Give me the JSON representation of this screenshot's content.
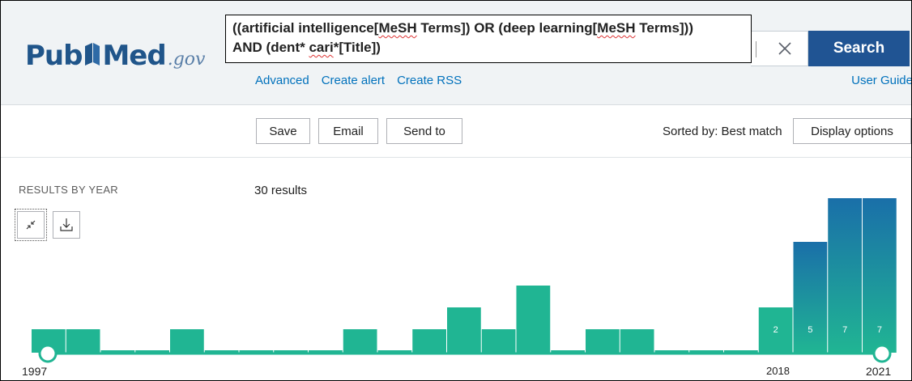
{
  "header": {
    "logo_pub": "Pub",
    "logo_med": "Med",
    "logo_gov": ".gov",
    "query_line1_a": "((artificial intelligence[",
    "query_line1_mesh1": "MeSH",
    "query_line1_b": " Terms]) OR (deep learning[",
    "query_line1_mesh2": "MeSH",
    "query_line1_c": " Terms]))",
    "query_line2_a": "AND (dent* ",
    "query_line2_cari": "cari",
    "query_line2_b": "*[Title])",
    "search_label": "Search",
    "links": [
      "Advanced",
      "Create alert",
      "Create RSS"
    ],
    "user_guide": "User Guide"
  },
  "toolbar": {
    "save": "Save",
    "email": "Email",
    "send_to": "Send to",
    "sorted_by": "Sorted by: Best match",
    "display_options": "Display options"
  },
  "results": {
    "section_label": "RESULTS BY YEAR",
    "count_text": "30 results"
  },
  "icons": {
    "collapse": "collapse-arrows-icon",
    "download": "download-icon",
    "clear": "close-icon"
  },
  "colors": {
    "brand": "#20558a",
    "search_button": "#205493",
    "link": "#0071bc",
    "bar": "#20b593",
    "bar_dark": "#1a6fa9",
    "timeline": "#20b593"
  },
  "chart_data": {
    "type": "bar",
    "categories": [
      "1997",
      "1998",
      "1999",
      "2000",
      "2001",
      "2002",
      "2003",
      "2004",
      "2005",
      "2006",
      "2007",
      "2008",
      "2009",
      "2010",
      "2011",
      "2012",
      "2013",
      "2014",
      "2015",
      "2016",
      "2017",
      "2018",
      "2019",
      "2020",
      "2021"
    ],
    "values": [
      1,
      1,
      0,
      0,
      1,
      0,
      0,
      0,
      0,
      1,
      0,
      1,
      2,
      1,
      3,
      0,
      1,
      1,
      0,
      0,
      0,
      2,
      5,
      7,
      7
    ],
    "data_labels": {
      "2018": "2",
      "2019": "5",
      "2020": "7",
      "2021": "7"
    },
    "axis_labels": {
      "start": "1997",
      "mid": "2018",
      "end": "2021"
    },
    "ylim": [
      0,
      7
    ]
  }
}
